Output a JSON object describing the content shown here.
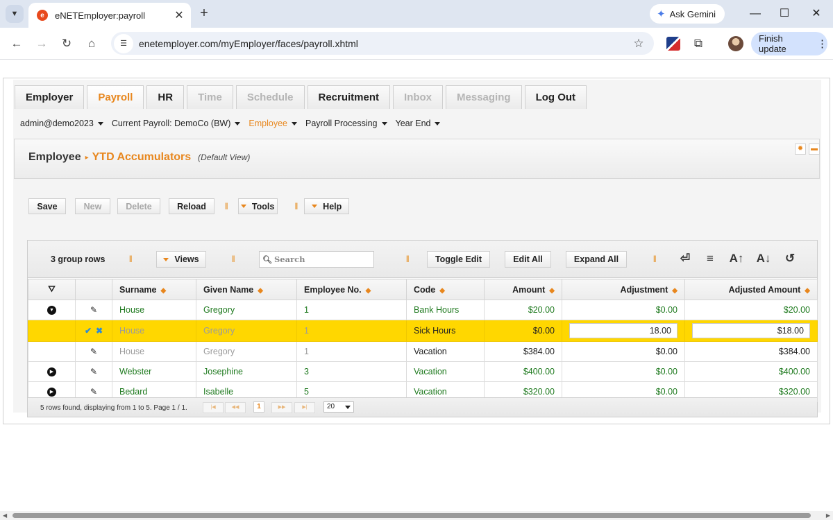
{
  "browser": {
    "tab_title": "eNETEmployer:payroll",
    "favicon_glyph": "e",
    "url": "enetemployer.com/myEmployer/faces/payroll.xhtml",
    "gemini_label": "Ask Gemini",
    "update_label": "Finish update"
  },
  "main_tabs": [
    {
      "label": "Employer",
      "state": "normal"
    },
    {
      "label": "Payroll",
      "state": "active"
    },
    {
      "label": "HR",
      "state": "normal"
    },
    {
      "label": "Time",
      "state": "disabled"
    },
    {
      "label": "Schedule",
      "state": "disabled"
    },
    {
      "label": "Recruitment",
      "state": "normal"
    },
    {
      "label": "Inbox",
      "state": "disabled"
    },
    {
      "label": "Messaging",
      "state": "disabled"
    },
    {
      "label": "Log Out",
      "state": "normal"
    }
  ],
  "sub_menu": {
    "user": "admin@demo2023",
    "current_payroll": "Current Payroll: DemoCo (BW)",
    "employee": "Employee",
    "payroll_processing": "Payroll Processing",
    "year_end": "Year End"
  },
  "breadcrumb": {
    "root": "Employee",
    "page": "YTD Accumulators",
    "view": "(Default View)"
  },
  "actions": {
    "save": "Save",
    "new": "New",
    "delete": "Delete",
    "reload": "Reload",
    "tools": "Tools",
    "help": "Help"
  },
  "grid_toolbar": {
    "group_rows": "3 group rows",
    "views": "Views",
    "search_placeholder": "Search",
    "toggle_edit": "Toggle Edit",
    "edit_all": "Edit All",
    "expand_all": "Expand All"
  },
  "columns": {
    "surname": "Surname",
    "given_name": "Given Name",
    "employee_no": "Employee No.",
    "code": "Code",
    "amount": "Amount",
    "adjustment": "Adjustment",
    "adjusted_amount": "Adjusted Amount"
  },
  "rows": [
    {
      "surname": "House",
      "given_name": "Gregory",
      "employee_no": "1",
      "code": "Bank Hours",
      "amount": "$20.00",
      "adjustment": "$0.00",
      "adjusted_amount": "$20.00"
    },
    {
      "surname": "House",
      "given_name": "Gregory",
      "employee_no": "1",
      "code": "Sick Hours",
      "amount": "$0.00",
      "adjustment": "18.00",
      "adjusted_amount": "$18.00"
    },
    {
      "surname": "House",
      "given_name": "Gregory",
      "employee_no": "1",
      "code": "Vacation",
      "amount": "$384.00",
      "adjustment": "$0.00",
      "adjusted_amount": "$384.00"
    },
    {
      "surname": "Webster",
      "given_name": "Josephine",
      "employee_no": "3",
      "code": "Vacation",
      "amount": "$400.00",
      "adjustment": "$0.00",
      "adjusted_amount": "$400.00"
    },
    {
      "surname": "Bedard",
      "given_name": "Isabelle",
      "employee_no": "5",
      "code": "Vacation",
      "amount": "$320.00",
      "adjustment": "$0.00",
      "adjusted_amount": "$320.00"
    }
  ],
  "pager": {
    "summary": "5 rows found, displaying from 1 to 5. Page 1 / 1.",
    "current_page": "1",
    "page_size": "20"
  },
  "colors": {
    "accent": "#e8871e",
    "editing_row": "#ffd700",
    "value_text": "#1f7a1f"
  }
}
